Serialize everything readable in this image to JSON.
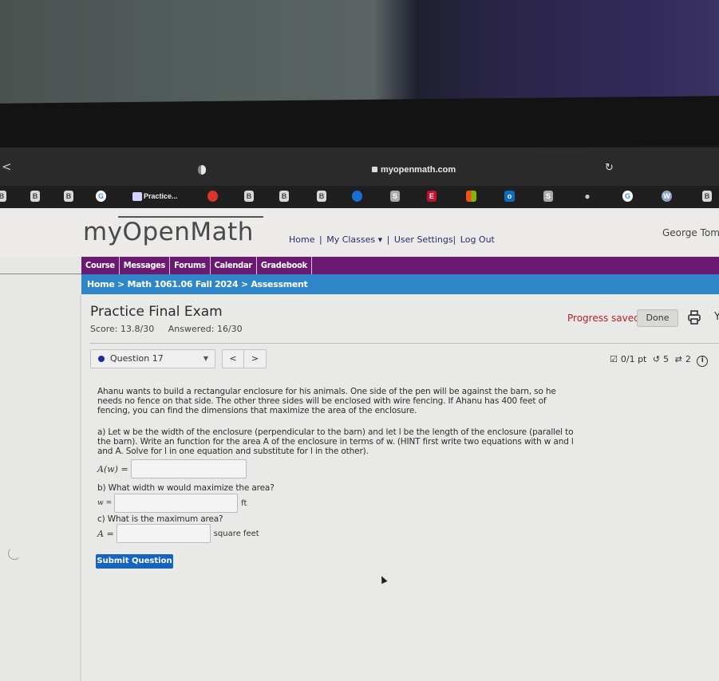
{
  "browser": {
    "url": "myopenmath.com",
    "back_label": "<",
    "bookmarks": [
      {
        "icon": "bookmark-page-icon"
      },
      {
        "icon": "bookmark-page-icon"
      },
      {
        "icon": "bookmark-page-icon"
      },
      {
        "icon": "google-icon"
      },
      {
        "icon": "myopenmath-icon",
        "label": "Practice..."
      },
      {
        "icon": "office-icon"
      },
      {
        "icon": "bookmark-page-icon"
      },
      {
        "icon": "bookmark-page-icon"
      },
      {
        "icon": "bookmark-page-icon"
      },
      {
        "icon": "blue-app-icon"
      },
      {
        "icon": "s-icon"
      },
      {
        "icon": "espn-icon"
      },
      {
        "icon": "microsoft-icon"
      },
      {
        "icon": "outlook-icon"
      },
      {
        "icon": "s-icon"
      },
      {
        "icon": "apple-icon"
      },
      {
        "icon": "google-icon"
      },
      {
        "icon": "wordpress-icon"
      },
      {
        "icon": "bookmark-page-icon"
      }
    ]
  },
  "header": {
    "logo": "myOpenMath",
    "links": [
      "Home",
      "|",
      "My Classes ▾",
      "|",
      "User Settings|",
      "Log Out"
    ],
    "username": "George Tom"
  },
  "nav": {
    "items": [
      "Course",
      "Messages",
      "Forums",
      "Calendar",
      "Gradebook"
    ]
  },
  "breadcrumb": "Home > Math 1061.06 Fall 2024 > Assessment",
  "assessment": {
    "title": "Practice Final Exam",
    "score": "Score: 13.8/30",
    "answered": "Answered: 16/30",
    "progress_status": "Progress saved",
    "done_label": "Done"
  },
  "question": {
    "selector_label": "Question 17",
    "prev_label": "<",
    "next_label": ">",
    "points": "0/1 pt",
    "retries": "5",
    "attempts": "2",
    "info_label": "i",
    "colors": {
      "dot": "#1a2aa0",
      "submit": "#1565c0",
      "progress_saved": "#b22222",
      "nav": "#6b1a72",
      "breadcrumb": "#2e86c8"
    },
    "intro": "Ahanu wants to build a rectangular enclosure for his animals. One side of the pen will be against the barn, so he needs no fence on that side. The other three sides will be enclosed with wire fencing. If Ahanu has 400 feet of fencing, you can find the dimensions that maximize the area of the enclosure.",
    "part_a": "a) Let w be the width of the enclosure (perpendicular to the barn) and let l be the length of the enclosure (parallel to the barn). Write an function for the area A of the enclosure in terms of w. (HINT first write two equations with w and l and A. Solve for l in one equation and substitute for l in the other).",
    "part_a_label": "A(w) =",
    "part_a_value": "",
    "part_b": "b) What width w would maximize the area?",
    "part_b_label": "w =",
    "part_b_value": "",
    "part_b_unit": "ft",
    "part_c": "c) What is the maximum area?",
    "part_c_label": "A =",
    "part_c_value": "",
    "part_c_unit": "square feet",
    "submit_label": "Submit Question"
  }
}
